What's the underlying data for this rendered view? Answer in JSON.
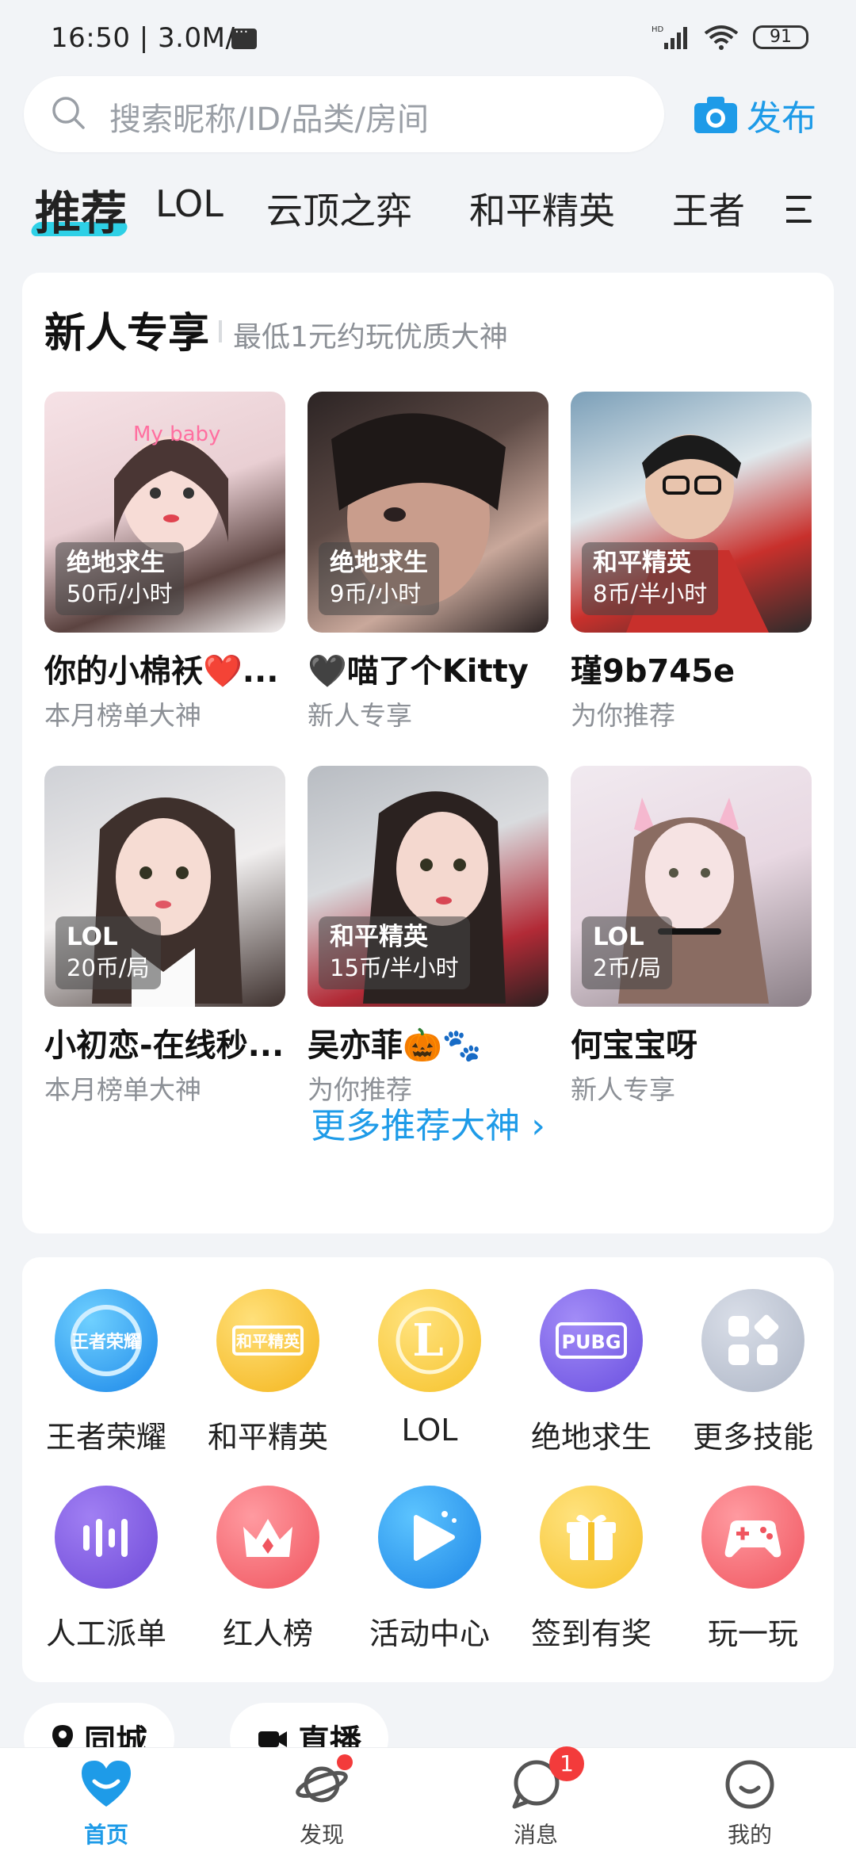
{
  "status_bar": {
    "time": "16:50 | 3.0M/s",
    "network": "HD",
    "battery": "91"
  },
  "search": {
    "placeholder": "搜索昵称/ID/品类/房间",
    "publish_label": "发布"
  },
  "tabs": [
    {
      "label": "推荐",
      "active": true
    },
    {
      "label": "LOL"
    },
    {
      "label": "云顶之弈"
    },
    {
      "label": "和平精英"
    },
    {
      "label": "王者"
    }
  ],
  "newcomer": {
    "title": "新人专享",
    "subtitle": "最低1元约玩优质大神",
    "players": [
      {
        "game": "绝地求生",
        "price": "50币/小时",
        "name": "你的小棉袄❤️...",
        "sub": "本月榜单大神"
      },
      {
        "game": "绝地求生",
        "price": "9币/小时",
        "name": "🖤喵了个Kitty",
        "sub": "新人专享"
      },
      {
        "game": "和平精英",
        "price": "8币/半小时",
        "name": "瑾9b745e",
        "sub": "为你推荐"
      },
      {
        "game": "LOL",
        "price": "20币/局",
        "name": "小初恋-在线秒...",
        "sub": "本月榜单大神"
      },
      {
        "game": "和平精英",
        "price": "15币/半小时",
        "name": "吴亦菲🎃🐾",
        "sub": "为你推荐"
      },
      {
        "game": "LOL",
        "price": "2币/局",
        "name": "何宝宝呀",
        "sub": "新人专享"
      }
    ],
    "more_label": "更多推荐大神 ›"
  },
  "skills": [
    {
      "label": "王者荣耀",
      "icon_text": "王者荣耀"
    },
    {
      "label": "和平精英",
      "icon_text": "和平精英"
    },
    {
      "label": "LOL",
      "icon_text": "L"
    },
    {
      "label": "绝地求生",
      "icon_text": "PUBG"
    },
    {
      "label": "更多技能",
      "icon_text": ""
    },
    {
      "label": "人工派单",
      "icon_text": ""
    },
    {
      "label": "红人榜",
      "icon_text": ""
    },
    {
      "label": "活动中心",
      "icon_text": ""
    },
    {
      "label": "签到有奖",
      "icon_text": ""
    },
    {
      "label": "玩一玩",
      "icon_text": ""
    }
  ],
  "chips": [
    {
      "label": "同城"
    },
    {
      "label": "直播"
    }
  ],
  "bottom_nav": [
    {
      "label": "首页",
      "active": true
    },
    {
      "label": "发现"
    },
    {
      "label": "消息",
      "badge": "1"
    },
    {
      "label": "我的"
    }
  ],
  "colors": {
    "accent": "#1e9be8",
    "tab_underline": "#2ed0e6",
    "badge": "#f33b3b"
  }
}
